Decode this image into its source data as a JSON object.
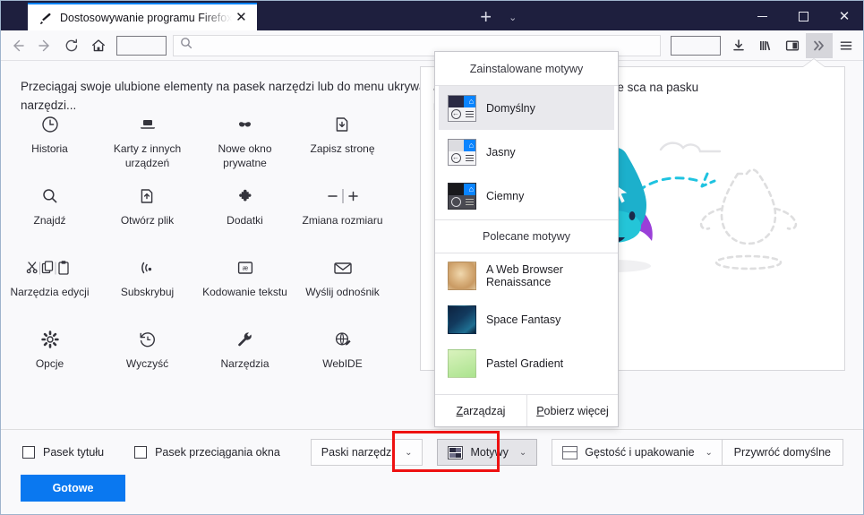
{
  "window": {
    "tab_title": "Dostosowywanie programu Firefox",
    "new_tab_label": "+",
    "list_tabs_label": "⌄",
    "minimize_label": "—",
    "maximize_label": "□",
    "close_label": "✕",
    "tab_close_label": "✕",
    "titlebar_color": "#1e1f3e",
    "accent_color": "#0a84ff"
  },
  "navbar": {
    "back_label": "←",
    "forward_label": "→",
    "reload_label": "⟳",
    "home_label": "⌂",
    "urlbar_placeholder": "",
    "downloads_label": "↓",
    "library_label": "|||\\",
    "sidebar_label": "▥",
    "overflow_label": "»",
    "menu_label": "☰"
  },
  "customize": {
    "hint": "Przeciągaj swoje ulubione elementy na pasek narzędzi lub do menu ukrywania rzeczy, aby były pod ręką, ale nie zajmowały miejsca na pasku narzędzi...",
    "content_text": "aj rzeczy, aby były pod ręką, ale nie sca na pasku narzędzi...",
    "palette": [
      {
        "label": "Historia",
        "icon": "clock-icon"
      },
      {
        "label": "Karty z innych urządzeń",
        "icon": "synced-tabs-icon"
      },
      {
        "label": "Nowe okno prywatne",
        "icon": "mask-icon"
      },
      {
        "label": "Zapisz stronę",
        "icon": "save-page-icon"
      },
      {
        "label": "Znajdź",
        "icon": "search-icon"
      },
      {
        "label": "Otwórz plik",
        "icon": "open-file-icon"
      },
      {
        "label": "Dodatki",
        "icon": "puzzle-icon"
      },
      {
        "label": "Zmiana rozmiaru",
        "icon": "zoom-controls-icon"
      },
      {
        "label": "Narzędzia edycji",
        "icon": "edit-tools-icon"
      },
      {
        "label": "Subskrybuj",
        "icon": "rss-icon"
      },
      {
        "label": "Kodowanie tekstu",
        "icon": "text-encoding-icon"
      },
      {
        "label": "Wyślij odnośnik",
        "icon": "email-link-icon"
      },
      {
        "label": "Opcje",
        "icon": "gear-icon"
      },
      {
        "label": "Wyczyść",
        "icon": "forget-history-icon"
      },
      {
        "label": "Narzędzia",
        "icon": "wrench-icon"
      },
      {
        "label": "WebIDE",
        "icon": "webide-icon"
      }
    ]
  },
  "themes_panel": {
    "installed_title": "Zainstalowane motywy",
    "recommended_title": "Polecane motywy",
    "installed": [
      {
        "name": "Domyślny",
        "selected": true,
        "tab_color": "#2b2b44",
        "chrome_color": "#f2f2f4",
        "accent": "#0a84ff"
      },
      {
        "name": "Jasny",
        "selected": false,
        "tab_color": "#dcdce0",
        "chrome_color": "#f2f2f4",
        "accent": "#0a84ff"
      },
      {
        "name": "Ciemny",
        "selected": false,
        "tab_color": "#19191c",
        "chrome_color": "#4a4a52",
        "accent": "#0a84ff"
      }
    ],
    "recommended": [
      {
        "name": "A Web Browser Renaissance",
        "thumb_color": "#d8b384"
      },
      {
        "name": "Space Fantasy",
        "thumb_color": "#10375c"
      },
      {
        "name": "Pastel Gradient",
        "thumb_color": "#b5e59b"
      }
    ],
    "manage_label": "Zarządzaj",
    "manage_accesskey": "Z",
    "get_more_label": "Pobierz więcej",
    "get_more_accesskey": "P"
  },
  "bottombar": {
    "titlebar_checkbox_label": "Pasek tytułu",
    "titlebar_checked": false,
    "dragspace_checkbox_label": "Pasek przeciągania okna",
    "dragspace_checked": false,
    "toolbars_label": "Paski narzędzi",
    "themes_label": "Motywy",
    "density_label": "Gęstość i upakowanie",
    "restore_defaults_label": "Przywróć domyślne",
    "done_label": "Gotowe",
    "chevron": "⌄",
    "highlight_color": "#ee1111",
    "done_color": "#0a78f0"
  }
}
